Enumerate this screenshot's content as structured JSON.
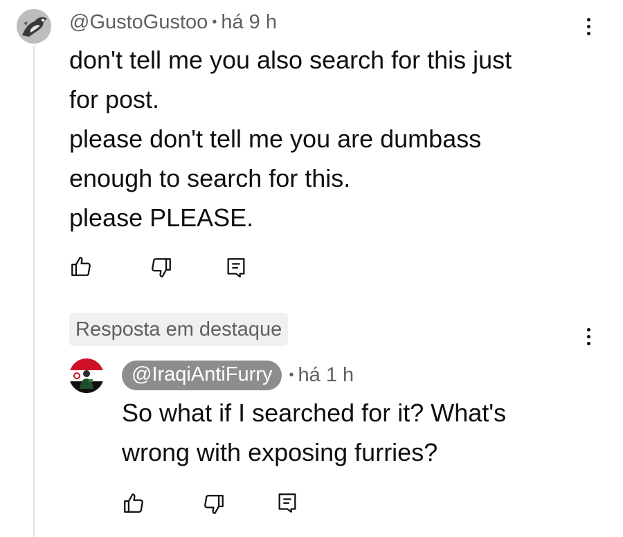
{
  "thread": {
    "comment": {
      "handle": "@GustoGustoo",
      "time": "há 9 h",
      "text_lines": [
        "don't tell me you also search for this just",
        "for post.",
        "please don't tell me you are dumbass",
        "enough to search for this.",
        "please PLEASE."
      ],
      "avatar_icon": "avatar-bird-image",
      "actions": [
        "like-icon",
        "dislike-icon",
        "reply-icon"
      ]
    },
    "highlight_label": "Resposta em destaque",
    "reply": {
      "handle": "@IraqiAntiFurry",
      "time": "há 1 h",
      "text_lines": [
        "So what if I searched for it? What's",
        "wrong with exposing furries?"
      ],
      "avatar_icon": "avatar-flag-person-image",
      "actions": [
        "like-icon",
        "dislike-icon",
        "reply-icon"
      ]
    },
    "more_icon": "more-vert-icon"
  },
  "colors": {
    "text": "#0f0f0f",
    "secondary": "#606060",
    "handle_pill_bg": "#8d8d8d",
    "badge_bg": "#f0f0f0",
    "thread_line": "#e5e5e5"
  }
}
